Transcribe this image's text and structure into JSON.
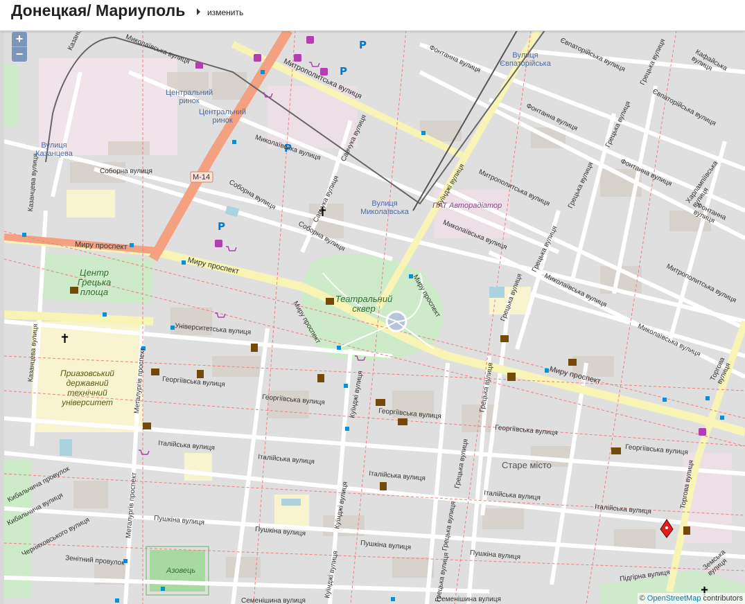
{
  "header": {
    "title": "Донецкая/ Мариуполь",
    "change_label": "изменить"
  },
  "zoom": {
    "in": "+",
    "out": "−"
  },
  "attribution": {
    "prefix": "©",
    "link": "OpenStreetMap",
    "suffix": "contributors"
  },
  "labels": {
    "kazantseva_st": "Казанцева вулиця",
    "mykolaivska_st": "Миколаївська вулиця",
    "mytropolytska_st": "Митрополитська вулиця",
    "kuindzhi_st": "Куїнджі вулиця",
    "savchuka_st": "Савчука вулиця",
    "sobornaya_st": "Соборна вулиця",
    "myru_pr": "Миру проспект",
    "universytetska_st": "Університетська вулиця",
    "heorhiivska_st": "Георгіївська вулиця",
    "italiiska_st": "Італійська вулиця",
    "pushkina_st": "Пушкіна вулиця",
    "semenishyna_st": "Семенішина вулиця",
    "metalurhiv_pr": "Металургів проспект",
    "hretska_st": "Грецька вулиця",
    "fontanna_st": "Фонтанна вулиця",
    "yevpatoriiska_st": "Євпаторійська вулиця",
    "kafaiska_st": "Кафайська вулиця",
    "torhova_st": "Торгова вулиця",
    "kharlampiivska_st": "Харлампіївська вулиця",
    "zemska_st": "Земська вулиця",
    "pidhirna_st": "Підгірна вулиця",
    "zenitnyi_pr": "Зенітний провулок",
    "kybalchycha_st": "Кибальчича вулиця",
    "cherniakhovskoho_st": "Черняховського вулиця",
    "kybalchycha_pr": "Кибальчича провулок",
    "m14": "М-14",
    "central_market_1": "Центральний ринок",
    "central_market_2": "Центральний ринок",
    "stop_kazantseva": "Вулиця Казанцева",
    "stop_mykolaivska": "Вулиця Миколаївська",
    "stop_yevpatoriiska": "Вулиця Євпаторійська",
    "pat_avtoradiator": "ПАТ Авторадіатор",
    "center_square": "Центр Грецька площа",
    "theatre_square": "Театральний сквер",
    "university": "Приазовський державний технічний університет",
    "stare_misto": "Старе місто",
    "azovets": "Азовець"
  }
}
